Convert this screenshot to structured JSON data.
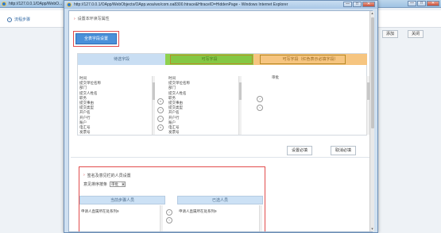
{
  "background_window": {
    "title": "http://127.0.0.1/OApp/WebO...",
    "header_label": "流程步骤",
    "buttons": [
      "添加",
      "关闭"
    ]
  },
  "dialog": {
    "title": "http://127.0.0.1/OApp/WebObjects/OApp.woa/wo/com.oa8300.htrace&HtraceID=HiddenPage - Windows Internet Explorer",
    "window_buttons": {
      "minimize": "—",
      "maximize": "□",
      "close": "✕"
    },
    "section_title": "设置本环读写属性",
    "set_all_button": "全表字段设置",
    "columns": {
      "left": "待选字段",
      "mid": "可写字段",
      "right": "可写字段（红色表示必填字段）"
    },
    "left_list": [
      "时间",
      "提交单位名称",
      "部门",
      "提交人姓名",
      "职务",
      "提交事由",
      "提交类型",
      "开户名",
      "开户行",
      "账户",
      "电汇号",
      "发票号",
      "发票时间",
      "报销金额"
    ],
    "mid_list": [
      "时间",
      "提交单位名称",
      "部门",
      "提交人姓名",
      "职务",
      "提交事由",
      "提交类型",
      "开户名",
      "开户行",
      "账户",
      "电汇号",
      "发票号",
      "发票时间"
    ],
    "right_list": [
      "审批"
    ],
    "move_buttons_1": [
      "»",
      "›",
      "‹",
      "«"
    ],
    "move_buttons_2": [
      "›",
      "‹"
    ],
    "footer_buttons": [
      "设置必填",
      "取消必填"
    ],
    "section2": {
      "title": "签名及意见栏的人员设置",
      "sort_label": "意见排序按条",
      "sort_select": "审批",
      "col_left": "当前步骤人员",
      "col_right": "已选人员",
      "row_left": "申请人直属所在处系列9",
      "row_right": "申请人直属所在处系列9",
      "move_buttons": [
        "›",
        "‹"
      ]
    },
    "scroll_up": "▲",
    "scroll_down": "▼"
  }
}
